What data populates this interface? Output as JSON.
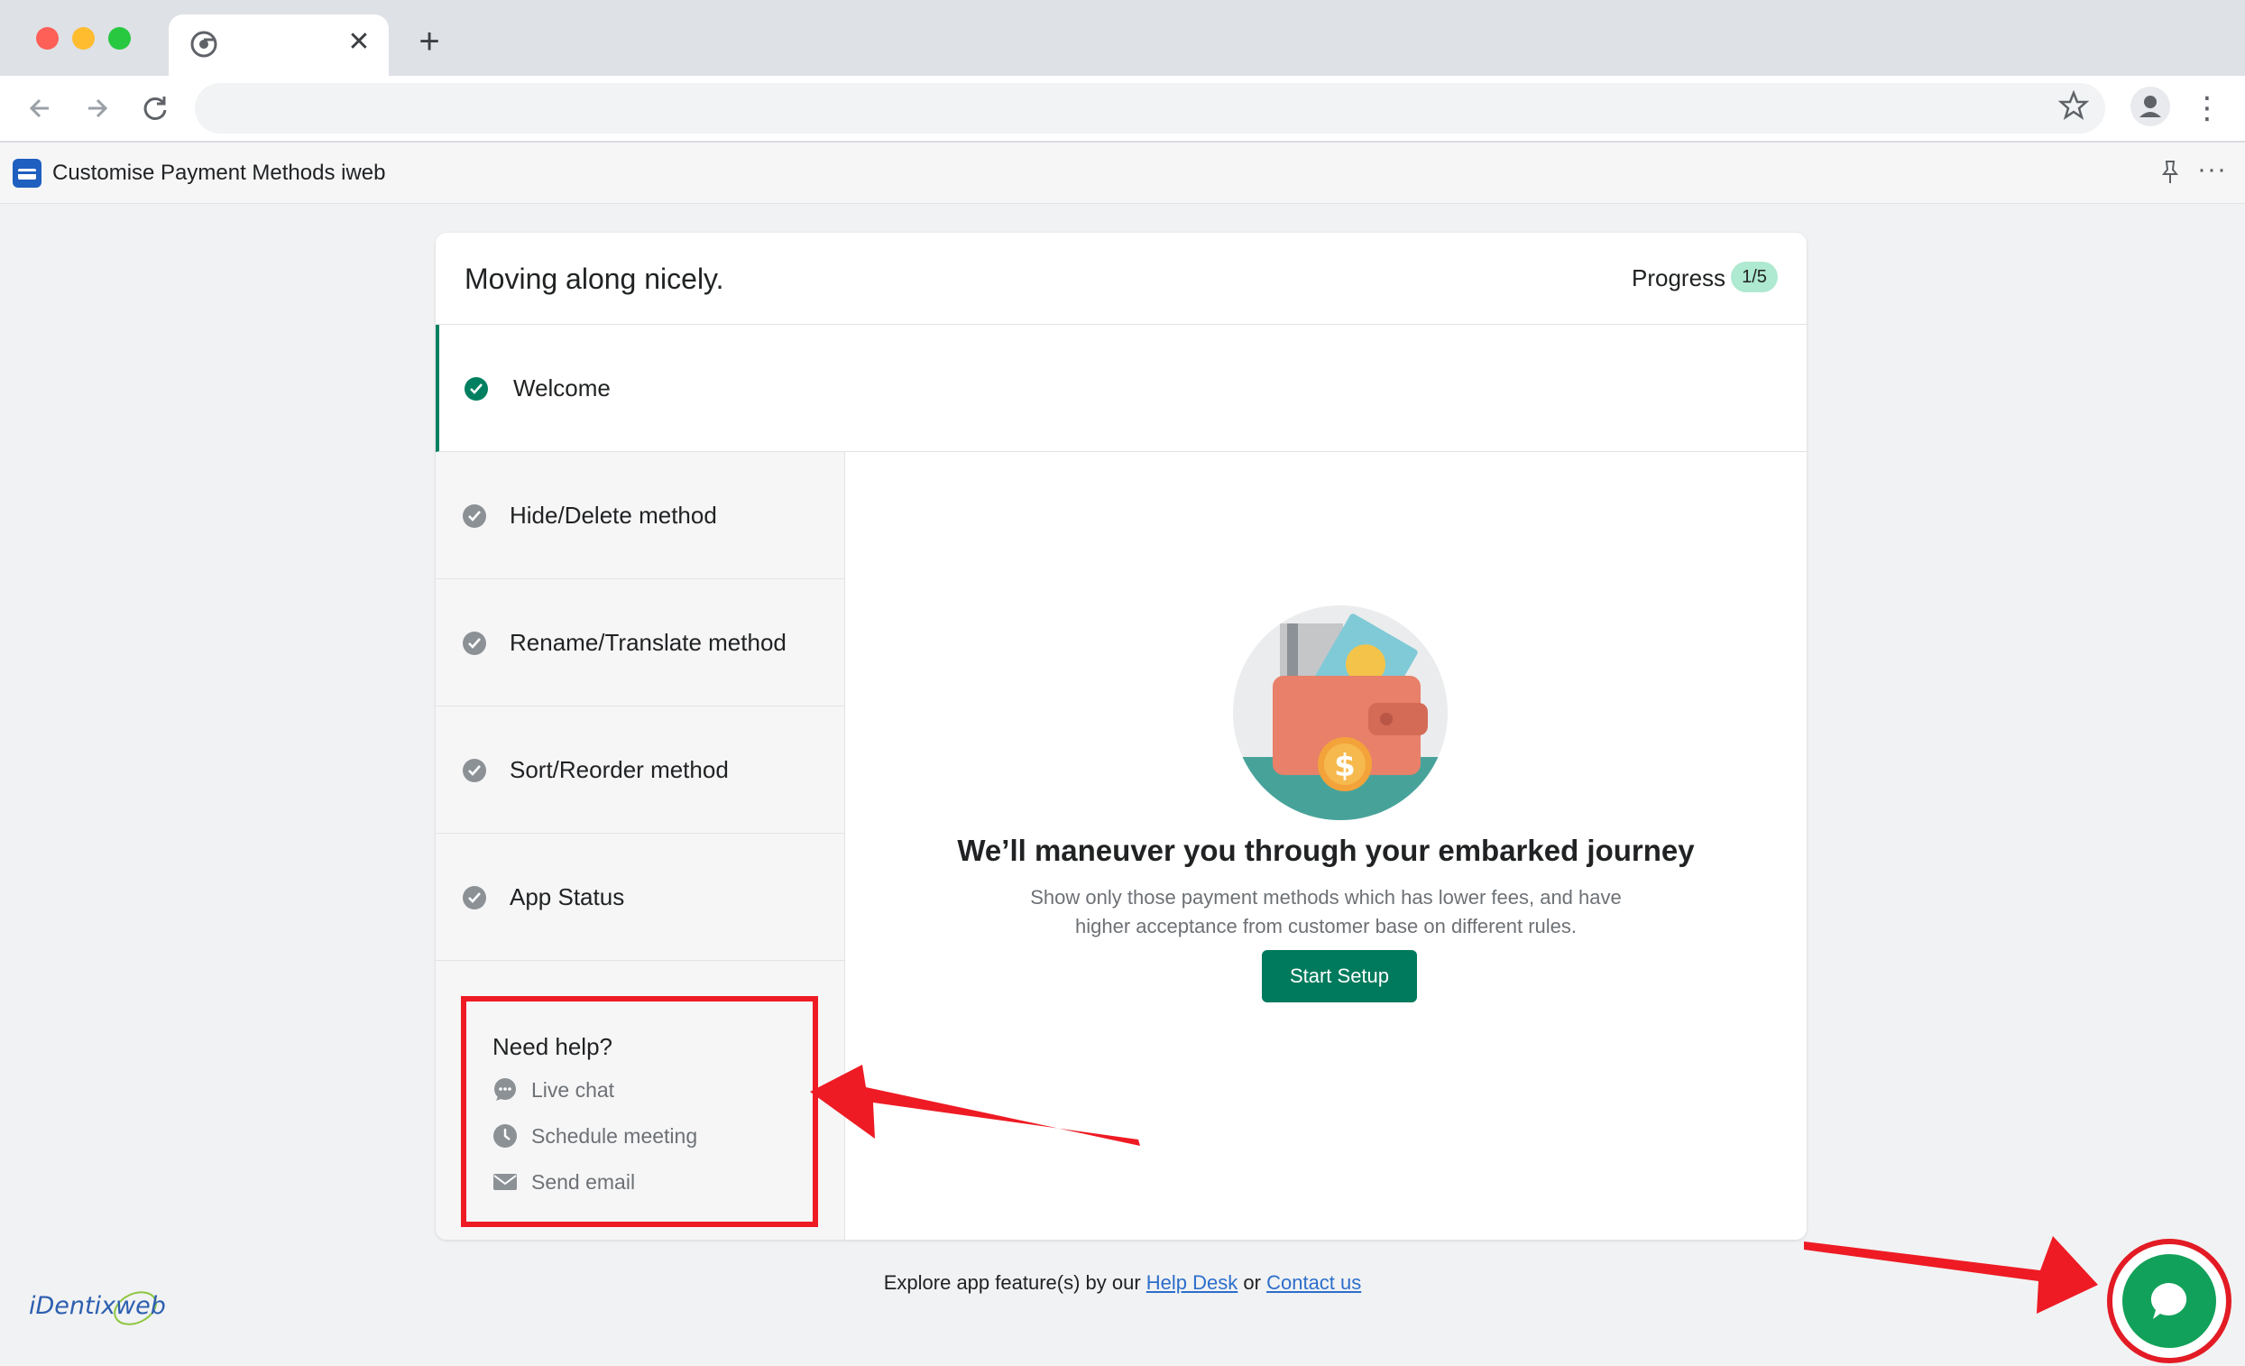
{
  "browser": {
    "new_tab": "+",
    "close_tab": "✕"
  },
  "app_bar": {
    "title": "Customise Payment Methods iweb"
  },
  "card": {
    "title": "Moving along nicely.",
    "progress_label": "Progress",
    "progress_value": "1/5"
  },
  "steps": [
    {
      "label": "Welcome",
      "state": "active"
    },
    {
      "label": "Hide/Delete method",
      "state": "pending"
    },
    {
      "label": "Rename/Translate method",
      "state": "pending"
    },
    {
      "label": "Sort/Reorder method",
      "state": "pending"
    },
    {
      "label": "App Status",
      "state": "pending"
    }
  ],
  "help": {
    "title": "Need help?",
    "items": [
      {
        "label": "Live chat",
        "icon": "chat-bubble-icon"
      },
      {
        "label": "Schedule meeting",
        "icon": "clock-icon"
      },
      {
        "label": "Send email",
        "icon": "envelope-icon"
      }
    ]
  },
  "main": {
    "headline": "We’ll maneuver you through your embarked journey",
    "description": "Show only those payment methods which has lower fees, and have higher acceptance from customer base on different rules.",
    "cta_label": "Start Setup"
  },
  "footer": {
    "prefix": "Explore app feature(s) by our",
    "help_desk": "Help Desk",
    "middle": "or",
    "contact": "Contact us"
  },
  "brand": {
    "name": "iDentixweb"
  },
  "colors": {
    "primary": "#008060",
    "badge": "#aee9d1",
    "annotation": "#ee1b24",
    "chat_button": "#12a15a"
  }
}
